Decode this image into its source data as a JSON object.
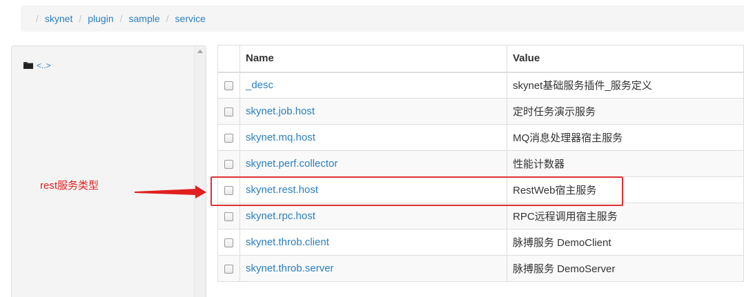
{
  "breadcrumb": {
    "items": [
      "skynet",
      "plugin",
      "sample",
      "service"
    ],
    "separator": "/"
  },
  "file_panel": {
    "parent_link": "<..>",
    "icon": "folder-icon"
  },
  "annotation": {
    "text": "rest服务类型",
    "color": "#e02020"
  },
  "table": {
    "headers": {
      "name": "Name",
      "value": "Value"
    },
    "rows": [
      {
        "name": "_desc",
        "value": "skynet基础服务插件_服务定义"
      },
      {
        "name": "skynet.job.host",
        "value": "定时任务演示服务"
      },
      {
        "name": "skynet.mq.host",
        "value": "MQ消息处理器宿主服务"
      },
      {
        "name": "skynet.perf.collector",
        "value": "性能计数器"
      },
      {
        "name": "skynet.rest.host",
        "value": "RestWeb宿主服务"
      },
      {
        "name": "skynet.rpc.host",
        "value": "RPC远程调用宿主服务"
      },
      {
        "name": "skynet.throb.client",
        "value": "脉搏服务 DemoClient"
      },
      {
        "name": "skynet.throb.server",
        "value": "脉搏服务 DemoServer"
      }
    ],
    "highlighted_row": "skynet.rest.host"
  },
  "colors": {
    "link": "#2a7fc0",
    "highlight": "#e03030"
  }
}
